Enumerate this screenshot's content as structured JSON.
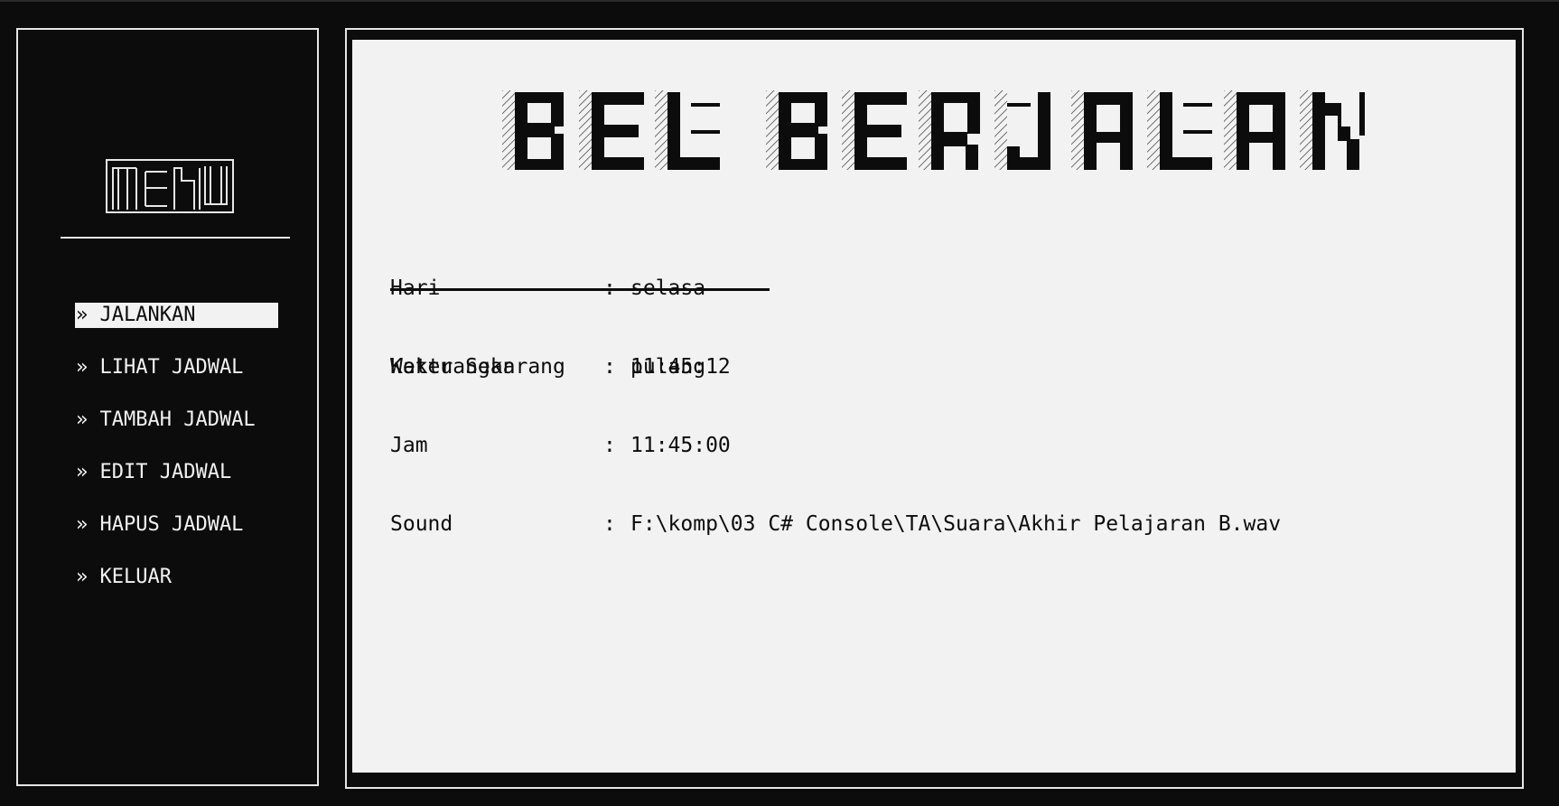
{
  "sidebar": {
    "logo_text": "MENU",
    "items": [
      {
        "label": "» JALANKAN",
        "active": true
      },
      {
        "label": "» LIHAT JADWAL",
        "active": false
      },
      {
        "label": "» TAMBAH JADWAL",
        "active": false
      },
      {
        "label": "» EDIT JADWAL",
        "active": false
      },
      {
        "label": "» HAPUS JADWAL",
        "active": false
      },
      {
        "label": "» KELUAR",
        "active": false
      }
    ]
  },
  "main": {
    "banner_text": "BEL BERJALAN",
    "status": {
      "hari_label": "Hari",
      "hari_value": "selasa",
      "waktu_label": "Waktu Sekarang",
      "waktu_value": "11:45:12"
    },
    "schedule": {
      "keterangan_label": "Keterangan",
      "keterangan_value": "pulang",
      "jam_label": "Jam",
      "jam_value": "11:45:00",
      "sound_label": "Sound",
      "sound_value": "F:\\komp\\03 C# Console\\TA\\Suara\\Akhir Pelajaran B.wav"
    },
    "separator": ":"
  },
  "colors": {
    "background": "#0c0c0c",
    "foreground": "#f2f2f2",
    "panel": "#f2f2f2",
    "border": "#e6e6e6"
  }
}
